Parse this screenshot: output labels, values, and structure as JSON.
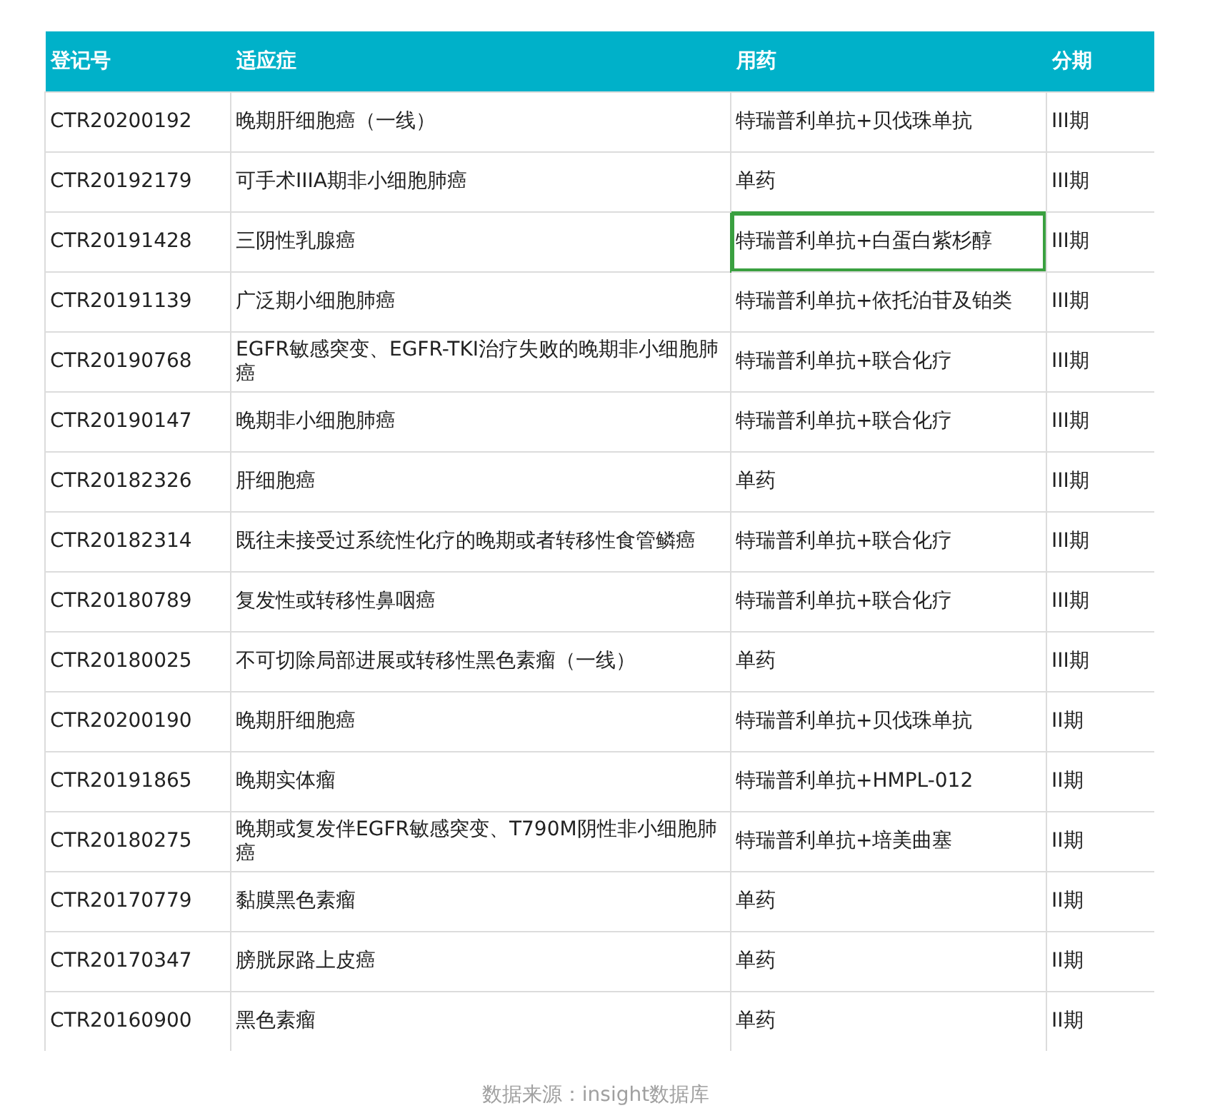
{
  "table": {
    "columns": [
      "登记号",
      "适应症",
      "用药",
      "分期"
    ],
    "rows": [
      {
        "id": "CTR20200192",
        "indication": "晚期肝细胞癌（一线）",
        "drug": "特瑞普利单抗+贝伐珠单抗",
        "phase": "III期",
        "drug_selected": false
      },
      {
        "id": "CTR20192179",
        "indication": "可手术IIIA期非小细胞肺癌",
        "drug": "单药",
        "phase": "III期",
        "drug_selected": false
      },
      {
        "id": "CTR20191428",
        "indication": "三阴性乳腺癌",
        "drug": "特瑞普利单抗+白蛋白紫杉醇",
        "phase": "III期",
        "drug_selected": true
      },
      {
        "id": "CTR20191139",
        "indication": "广泛期小细胞肺癌",
        "drug": "特瑞普利单抗+依托泊苷及铂类",
        "phase": "III期",
        "drug_selected": false
      },
      {
        "id": "CTR20190768",
        "indication": "EGFR敏感突变、EGFR-TKI治疗失败的晚期非小细胞肺癌",
        "drug": "特瑞普利单抗+联合化疗",
        "phase": "III期",
        "drug_selected": false
      },
      {
        "id": "CTR20190147",
        "indication": "晚期非小细胞肺癌",
        "drug": "特瑞普利单抗+联合化疗",
        "phase": "III期",
        "drug_selected": false
      },
      {
        "id": "CTR20182326",
        "indication": "肝细胞癌",
        "drug": "单药",
        "phase": "III期",
        "drug_selected": false
      },
      {
        "id": "CTR20182314",
        "indication": "既往未接受过系统性化疗的晚期或者转移性食管鳞癌",
        "drug": "特瑞普利单抗+联合化疗",
        "phase": "III期",
        "drug_selected": false
      },
      {
        "id": "CTR20180789",
        "indication": "复发性或转移性鼻咽癌",
        "drug": "特瑞普利单抗+联合化疗",
        "phase": "III期",
        "drug_selected": false
      },
      {
        "id": "CTR20180025",
        "indication": "不可切除局部进展或转移性黑色素瘤（一线）",
        "drug": "单药",
        "phase": "III期",
        "drug_selected": false
      },
      {
        "id": "CTR20200190",
        "indication": "晚期肝细胞癌",
        "drug": "特瑞普利单抗+贝伐珠单抗",
        "phase": "II期",
        "drug_selected": false
      },
      {
        "id": "CTR20191865",
        "indication": "晚期实体瘤",
        "drug": "特瑞普利单抗+HMPL-012",
        "phase": "II期",
        "drug_selected": false
      },
      {
        "id": "CTR20180275",
        "indication": "晚期或复发伴EGFR敏感突变、T790M阴性非小细胞肺癌",
        "drug": "特瑞普利单抗+培美曲塞",
        "phase": "II期",
        "drug_selected": false
      },
      {
        "id": "CTR20170779",
        "indication": "黏膜黑色素瘤",
        "drug": "单药",
        "phase": "II期",
        "drug_selected": false
      },
      {
        "id": "CTR20170347",
        "indication": "膀胱尿路上皮癌",
        "drug": "单药",
        "phase": "II期",
        "drug_selected": false
      },
      {
        "id": "CTR20160900",
        "indication": "黑色素瘤",
        "drug": "单药",
        "phase": "II期",
        "drug_selected": false
      }
    ]
  },
  "caption": "数据来源：insight数据库"
}
